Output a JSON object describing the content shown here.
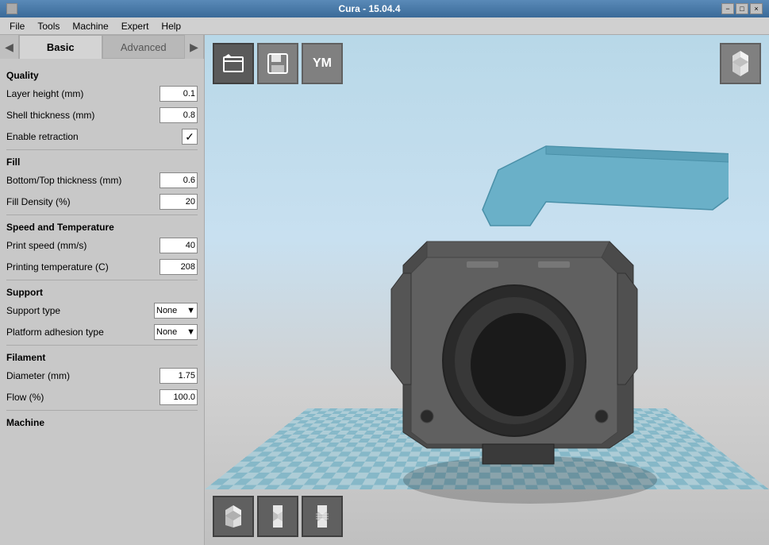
{
  "app": {
    "title": "Cura - 15.04.4",
    "title_icon": "□",
    "controls": {
      "minimize": "−",
      "restore": "□",
      "close": "×"
    }
  },
  "menu": {
    "items": [
      "File",
      "Tools",
      "Machine",
      "Expert",
      "Help"
    ]
  },
  "tabs": {
    "left_arrow": "◀",
    "right_arrow": "▶",
    "basic": "Basic",
    "advanced": "Advanced"
  },
  "quality": {
    "header": "Quality",
    "layer_height_label": "Layer height (mm)",
    "layer_height_value": "0.1",
    "shell_thickness_label": "Shell thickness (mm)",
    "shell_thickness_value": "0.8",
    "enable_retraction_label": "Enable retraction",
    "enable_retraction_checked": true
  },
  "fill": {
    "header": "Fill",
    "bottom_top_thickness_label": "Bottom/Top thickness (mm)",
    "bottom_top_thickness_value": "0.6",
    "fill_density_label": "Fill Density (%)",
    "fill_density_value": "20"
  },
  "speed": {
    "header": "Speed and Temperature",
    "print_speed_label": "Print speed (mm/s)",
    "print_speed_value": "40",
    "printing_temp_label": "Printing temperature (C)",
    "printing_temp_value": "208"
  },
  "support": {
    "header": "Support",
    "support_type_label": "Support type",
    "support_type_value": "None",
    "platform_adhesion_label": "Platform adhesion type",
    "platform_adhesion_value": "None"
  },
  "filament": {
    "header": "Filament",
    "diameter_label": "Diameter (mm)",
    "diameter_value": "1.75",
    "flow_label": "Flow (%)",
    "flow_value": "100.0"
  },
  "machine": {
    "header": "Machine"
  },
  "toolbar_top": {
    "btn1_icon": "⊕",
    "btn2_icon": "▦",
    "btn3_label": "YM"
  },
  "toolbar_top_right": {
    "icon": "⧖"
  },
  "toolbar_bottom": {
    "btn1_icon": "⧖",
    "btn2_icon": "⧖",
    "btn3_icon": "⧖"
  }
}
